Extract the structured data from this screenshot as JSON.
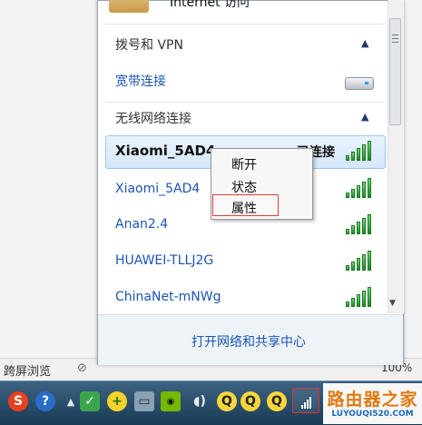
{
  "flyout": {
    "top_item_label": "Internet 访问",
    "dialup_group": {
      "title": "拨号和 VPN",
      "connection": "宽带连接"
    },
    "wireless_group": {
      "title": "无线网络连接",
      "networks": [
        {
          "name": "Xiaomi_5AD4",
          "status": "已连接"
        },
        {
          "name": "Xiaomi_5AD4"
        },
        {
          "name": "Anan2.4"
        },
        {
          "name": "HUAWEI-TLLJ2G"
        },
        {
          "name": "ChinaNet-mNWg"
        }
      ]
    },
    "footer_link": "打开网络和共享中心"
  },
  "context_menu": {
    "items": [
      "断开",
      "状态",
      "属性"
    ],
    "highlighted_index": 2
  },
  "background_window": {
    "status_text": "跨屏浏览",
    "right_text": "100%"
  },
  "taskbar": {
    "icons": [
      "sogou-icon",
      "help-icon",
      "shield-icon",
      "plus-icon",
      "monitor-icon",
      "nvidia-icon",
      "speaker-icon",
      "qq-icon",
      "qq-icon",
      "qq-icon",
      "network-icon"
    ]
  },
  "watermark": {
    "main": "路由器之家",
    "sub": "LUYOUQI520.COM"
  },
  "colors": {
    "link": "#1a55b5",
    "selection_border": "#9cc3ec",
    "highlight_box": "#e03a3a",
    "signal": "#1e8a2c"
  }
}
